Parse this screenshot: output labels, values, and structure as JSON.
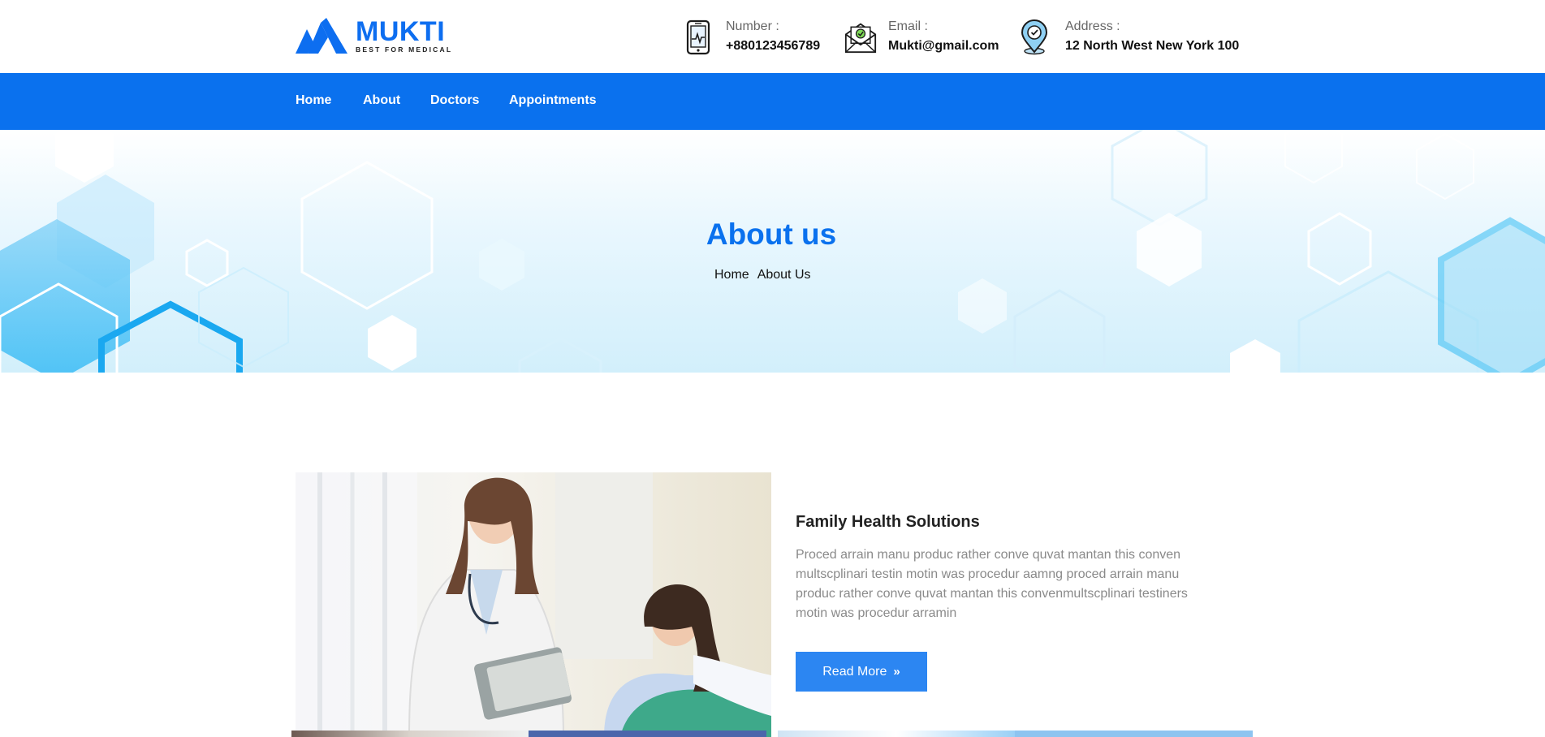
{
  "brand": {
    "name": "MUKTI",
    "tagline": "BEST FOR MEDICAL",
    "color": "#0d6ef0"
  },
  "contacts": {
    "number": {
      "label": "Number :",
      "value": "+880123456789",
      "icon": "tablet-health-icon"
    },
    "email": {
      "label": "Email :",
      "value": "Mukti@gmail.com",
      "icon": "envelope-check-icon"
    },
    "address": {
      "label": "Address :",
      "value": "12 North West New York 100",
      "icon": "location-pin-check-icon"
    }
  },
  "nav": {
    "home": "Home",
    "about": "About",
    "doctors": "Doctors",
    "appointments": "Appointments",
    "background": "#0a71ee"
  },
  "hero": {
    "title": "About us",
    "breadcrumb": [
      "Home",
      "About Us"
    ]
  },
  "about": {
    "heading": "Family Health Solutions",
    "text": "Proced arrain manu produc rather conve quvat mantan this conven multscplinari testin motin was procedur aamng proced arrain manu produc rather conve quvat mantan this convenmultscplinari testiners motin was procedur arramin",
    "button": "Read More",
    "button_icon": "double-chevron-right-icon",
    "button_color": "#2c86f2"
  }
}
